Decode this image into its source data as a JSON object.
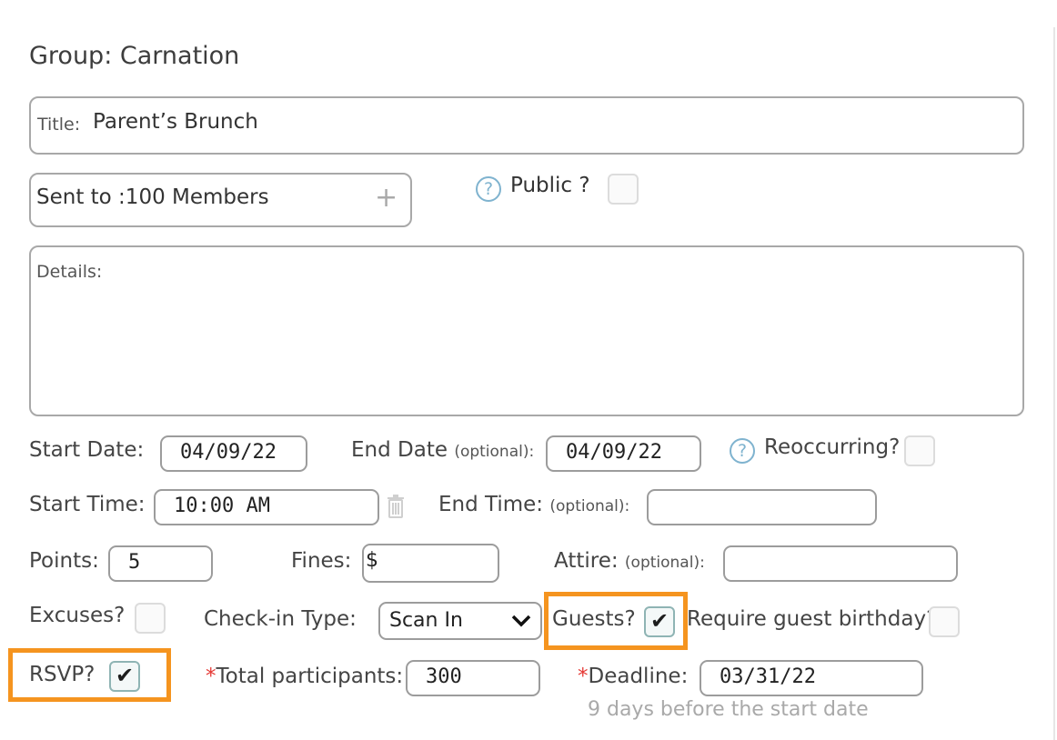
{
  "group": {
    "label": "Group:",
    "name": "Carnation"
  },
  "title": {
    "label": "Title:",
    "value": "Parent’s Brunch"
  },
  "sent_to": {
    "label": "Sent to :100 Members",
    "add_symbol": "+"
  },
  "public": {
    "label": "Public ?",
    "checked": false
  },
  "details": {
    "label": "Details:"
  },
  "start_date": {
    "label": "Start Date:",
    "value": "04/09/22"
  },
  "end_date": {
    "label": "End Date",
    "optional": "(optional):",
    "value": "04/09/22"
  },
  "reoccurring": {
    "label": "Reoccurring?",
    "checked": false
  },
  "start_time": {
    "label": "Start Time:",
    "value": "10:00 AM"
  },
  "end_time": {
    "label": "End Time:",
    "optional": "(optional):",
    "value": ""
  },
  "points": {
    "label": "Points:",
    "value": "5"
  },
  "fines": {
    "label": "Fines:",
    "value": "$"
  },
  "attire": {
    "label": "Attire:",
    "optional": "(optional):",
    "value": ""
  },
  "excuses": {
    "label": "Excuses?",
    "checked": false
  },
  "checkin": {
    "label": "Check-in Type:",
    "value": "Scan In"
  },
  "guests": {
    "label": "Guests?",
    "checked": true
  },
  "require_birthday": {
    "label": "Require guest birthday?",
    "checked": false
  },
  "rsvp": {
    "label": "RSVP?",
    "checked": true
  },
  "total_participants": {
    "required_mark": "*",
    "label": "Total participants:",
    "value": "300"
  },
  "deadline": {
    "required_mark": "*",
    "label": "Deadline:",
    "value": "03/31/22",
    "hint": "9 days before the start date"
  },
  "icons": {
    "help": "question-circle-icon",
    "trash": "trash-icon",
    "dropdown": "chevron-down-icon",
    "plus": "plus-icon"
  },
  "colors": {
    "highlight": "#f5941f",
    "help_icon": "#7fb3cf",
    "required": "#e53935"
  }
}
